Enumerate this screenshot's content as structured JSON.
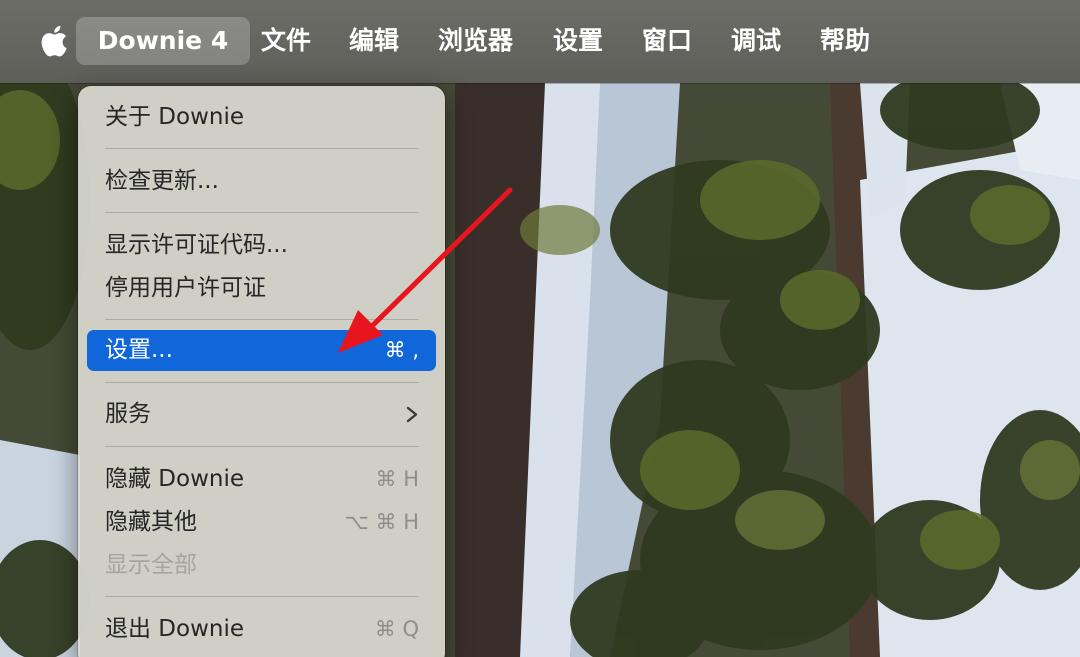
{
  "menubar": {
    "apple_icon": "apple-logo-icon",
    "app_name": "Downie 4",
    "items": [
      "文件",
      "编辑",
      "浏览器",
      "设置",
      "窗口",
      "调试",
      "帮助"
    ]
  },
  "app_menu": {
    "items": [
      {
        "label": "关于 Downie",
        "shortcut": "",
        "enabled": true
      },
      {
        "label": "检查更新...",
        "shortcut": "",
        "enabled": true
      },
      {
        "label": "显示许可证代码...",
        "shortcut": "",
        "enabled": true
      },
      {
        "label": "停用用户许可证",
        "shortcut": "",
        "enabled": true
      },
      {
        "label": "设置...",
        "shortcut": "⌘ ,",
        "enabled": true,
        "highlighted": true
      },
      {
        "label": "服务",
        "shortcut": "",
        "enabled": true,
        "submenu": true
      },
      {
        "label": "隐藏 Downie",
        "shortcut": "⌘ H",
        "enabled": true
      },
      {
        "label": "隐藏其他",
        "shortcut": "⌥ ⌘ H",
        "enabled": true
      },
      {
        "label": "显示全部",
        "shortcut": "",
        "enabled": false
      },
      {
        "label": "退出 Downie",
        "shortcut": "⌘ Q",
        "enabled": true
      }
    ]
  },
  "colors": {
    "highlight": "#1167da",
    "annotation_arrow": "#e8141e"
  },
  "icons": {
    "submenu": "chevron-right-icon"
  }
}
